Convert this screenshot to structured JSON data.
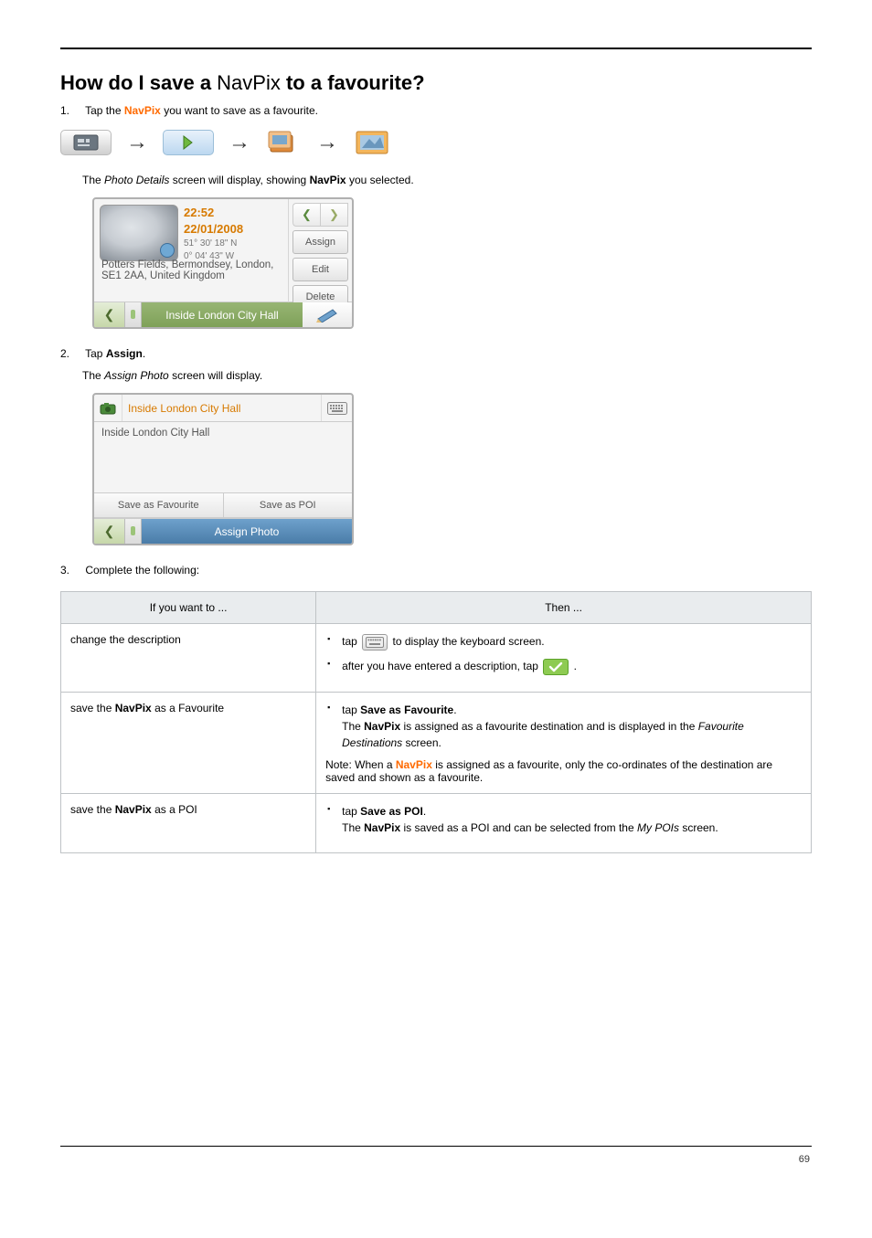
{
  "page": {
    "number": "69"
  },
  "heading": {
    "pre": "How do I save a ",
    "nav": "NavPix",
    "post": " to a favourite?"
  },
  "intro": {
    "step_num": "1.",
    "step_text_pre": "Tap the ",
    "step_nav": "NavPix",
    "step_text_post": " you want to save as a favourite."
  },
  "line2": {
    "pre": "The ",
    "bold": "Photo Details",
    "post": " screen will display, showing ",
    "nav": "NavPix",
    "post2": " you selected."
  },
  "shot1": {
    "time": "22:52",
    "date": "22/01/2008",
    "coord1": "51° 30' 18\" N",
    "coord2": "0° 04' 43\" W",
    "address": "Potters Fields, Bermondsey, London, SE1 2AA, United Kingdom",
    "btn_assign": "Assign",
    "btn_edit": "Edit",
    "btn_delete": "Delete",
    "bar_title": "Inside London City Hall"
  },
  "step2": {
    "num": "2.",
    "text_pre": "Tap ",
    "bold": "Assign",
    "text_post": ".",
    "sub_pre": "The ",
    "sub_bold": "Assign Photo",
    "sub_post": " screen will display."
  },
  "shot2": {
    "header_label": "Inside London City Hall",
    "body_text": "Inside London City Hall",
    "btn_fav": "Save as Favourite",
    "btn_poi": "Save as POI",
    "bar_title": "Assign Photo"
  },
  "step3": {
    "num": "3.",
    "text": "Complete the following:"
  },
  "table": {
    "headers": {
      "c1": "If you want to ...",
      "c2": "Then ..."
    },
    "rows": [
      {
        "c1": "change the description",
        "c2_items": [
          {
            "pre": "tap ",
            "icon": "kbd",
            "post": " to display the keyboard screen."
          },
          {
            "pre": "after you have entered a description, tap ",
            "icon": "ok_green",
            "post": "."
          }
        ]
      },
      {
        "c1_pre": "save the ",
        "c1_nav": "NavPix",
        "c1_post": " as a Favourite",
        "c2_items": [
          {
            "pre": "tap ",
            "bold": "Save as Favourite",
            "post": ".",
            "line2_pre": "The ",
            "line2_nav": "NavPix",
            "line2_post": " is assigned as a favourite destination and is displayed in the ",
            "line2_italic": "Favourite Destinations",
            "line2_post2": " screen."
          }
        ],
        "note_pre": "Note: When a ",
        "note_nav": "NavPix",
        "note_post": " is assigned as a favourite, only the co-ordinates of the destination are saved and shown as a favourite."
      },
      {
        "c1_pre": "save the ",
        "c1_nav": "NavPix",
        "c1_post": " as a POI",
        "c2_items": [
          {
            "pre": "tap ",
            "bold": "Save as POI",
            "post": ".",
            "line2_pre": "The ",
            "line2_nav": "NavPix",
            "line2_post": " is saved as a POI and can be selected from the ",
            "line2_italic": "My POIs",
            "line2_post2": " screen."
          }
        ]
      }
    ]
  },
  "icons": {
    "photo_app": "photo-app-icon",
    "next_green": "next-arrow-icon",
    "album": "album-icon",
    "photo": "photo-icon",
    "kbd": "keyboard-icon",
    "ok": "ok-icon",
    "pencil": "pencil-icon",
    "camera": "camera-icon",
    "back": "back-chevron-icon"
  }
}
